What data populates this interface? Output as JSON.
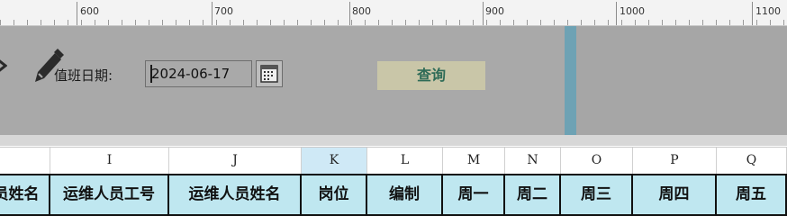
{
  "ruler": {
    "labels": [
      "600",
      "700",
      "800",
      "900",
      "1000",
      "1100"
    ]
  },
  "form": {
    "date_label": "值班日期:",
    "date_value": "2024-06-17",
    "query_label": "查询"
  },
  "icons": {
    "edit": "pencil-icon",
    "calendar": "calendar-icon"
  },
  "columns": {
    "letters": [
      "",
      "I",
      "J",
      "K",
      "L",
      "M",
      "N",
      "O",
      "P",
      "Q"
    ],
    "selected": "K"
  },
  "header": {
    "cells": [
      "员姓名",
      "运维人员工号",
      "运维人员姓名",
      "岗位",
      "编制",
      "周一",
      "周二",
      "周三",
      "周四",
      "周五"
    ]
  },
  "colors": {
    "panel_bg": "#a9a9a9",
    "header_bg": "#bfe7f0",
    "accent_bar": "#6ea2b4",
    "query_text": "#2e6b57",
    "query_bg": "#c9c6a8"
  }
}
